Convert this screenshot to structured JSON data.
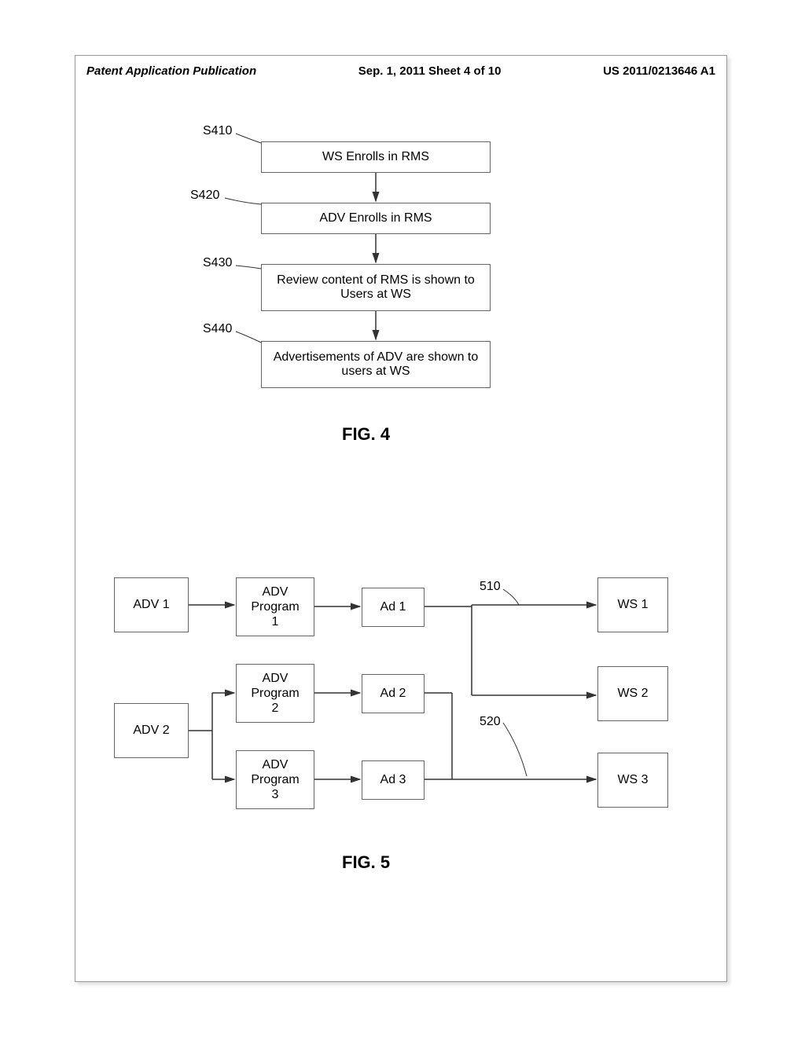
{
  "header": {
    "left": "Patent Application Publication",
    "mid": "Sep. 1, 2011   Sheet 4 of 10",
    "right": "US 2011/0213646 A1"
  },
  "fig4": {
    "label": "FIG. 4",
    "steps": {
      "s410": {
        "ref": "S410",
        "text": "WS Enrolls in RMS"
      },
      "s420": {
        "ref": "S420",
        "text": "ADV Enrolls in RMS"
      },
      "s430": {
        "ref": "S430",
        "text": "Review content of RMS is shown to Users at WS"
      },
      "s440": {
        "ref": "S440",
        "text": "Advertisements of ADV are shown to users at WS"
      }
    }
  },
  "fig5": {
    "label": "FIG. 5",
    "refs": {
      "r510": "510",
      "r520": "520"
    },
    "boxes": {
      "adv1": "ADV 1",
      "adv2": "ADV 2",
      "prog1a": "ADV",
      "prog1b": "Program",
      "prog1c": "1",
      "prog2a": "ADV",
      "prog2b": "Program",
      "prog2c": "2",
      "prog3a": "ADV",
      "prog3b": "Program",
      "prog3c": "3",
      "ad1": "Ad 1",
      "ad2": "Ad 2",
      "ad3": "Ad 3",
      "ws1": "WS 1",
      "ws2": "WS 2",
      "ws3": "WS 3"
    }
  }
}
